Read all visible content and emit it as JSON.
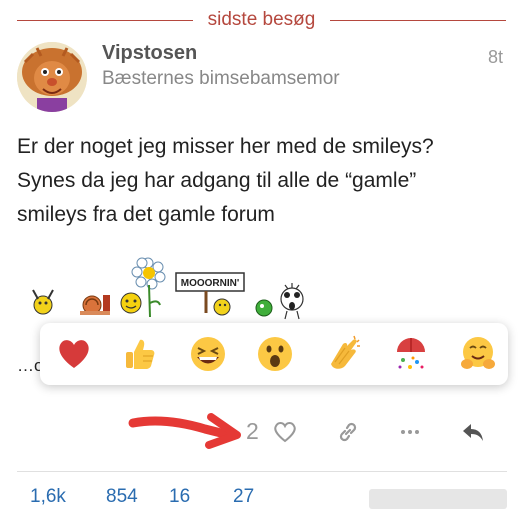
{
  "divider": {
    "label": "sidste besøg"
  },
  "post": {
    "username": "Vipstosen",
    "user_title": "Bæsternes bimsebamsemor",
    "date": "8t",
    "body": [
      "Er der noget jeg misser her med de smileys?",
      "Synes da jeg har adgang til alle de “gamle”",
      "smileys fra det gamle forum"
    ],
    "sign_text": "MOOORNIN'",
    "partial_text": "…o"
  },
  "reactions": [
    "heart",
    "thumbsup",
    "laughing",
    "open-mouth",
    "clapping-hands",
    "confetti-ball",
    "hugging-face"
  ],
  "actions": {
    "like_count": "2"
  },
  "stats": [
    "1,6k",
    "854",
    "16",
    "27"
  ],
  "colors": {
    "accent": "#b5483e",
    "link": "#2a6cb0",
    "arrow": "#e53935"
  }
}
